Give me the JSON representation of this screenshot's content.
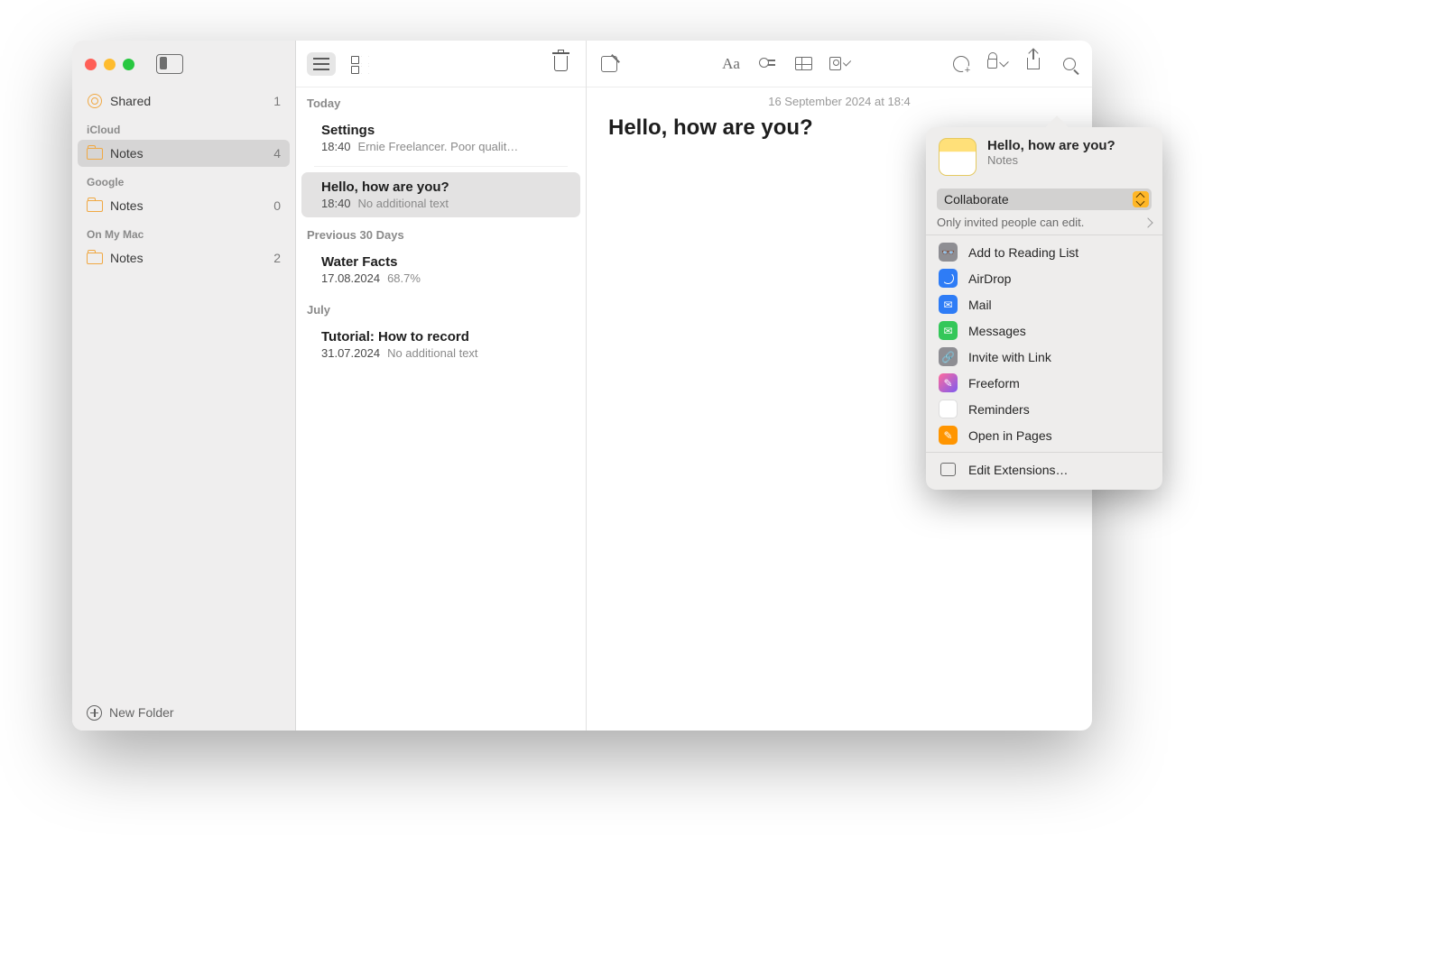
{
  "sidebar": {
    "shared": {
      "label": "Shared",
      "count": "1"
    },
    "sections": [
      {
        "header": "iCloud",
        "items": [
          {
            "label": "Notes",
            "count": "4",
            "selected": true
          }
        ]
      },
      {
        "header": "Google",
        "items": [
          {
            "label": "Notes",
            "count": "0"
          }
        ]
      },
      {
        "header": "On My Mac",
        "items": [
          {
            "label": "Notes",
            "count": "2"
          }
        ]
      }
    ],
    "new_folder": "New Folder"
  },
  "notelist": {
    "sections": [
      {
        "header": "Today",
        "items": [
          {
            "title": "Settings",
            "time": "18:40",
            "snippet": "Ernie Freelancer. Poor qualit…"
          },
          {
            "title": "Hello, how are you?",
            "time": "18:40",
            "snippet": "No additional text",
            "selected": true
          }
        ]
      },
      {
        "header": "Previous 30 Days",
        "items": [
          {
            "title": "Water Facts",
            "time": "17.08.2024",
            "snippet": "68.7%"
          }
        ]
      },
      {
        "header": "July",
        "items": [
          {
            "title": "Tutorial: How to record",
            "time": "31.07.2024",
            "snippet": "No additional text"
          }
        ]
      }
    ]
  },
  "editor": {
    "date": "16 September 2024 at 18:4",
    "title": "Hello, how are you?"
  },
  "popover": {
    "head_title": "Hello, how are you?",
    "head_sub": "Notes",
    "mode": "Collaborate",
    "permissions": "Only invited people can edit.",
    "items": [
      {
        "label": "Add to Reading List",
        "icon": "read"
      },
      {
        "label": "AirDrop",
        "icon": "air"
      },
      {
        "label": "Mail",
        "icon": "mail"
      },
      {
        "label": "Messages",
        "icon": "msg"
      },
      {
        "label": "Invite with Link",
        "icon": "link"
      },
      {
        "label": "Freeform",
        "icon": "free"
      },
      {
        "label": "Reminders",
        "icon": "rem"
      },
      {
        "label": "Open in Pages",
        "icon": "pages"
      }
    ],
    "edit_ext": "Edit Extensions…"
  }
}
